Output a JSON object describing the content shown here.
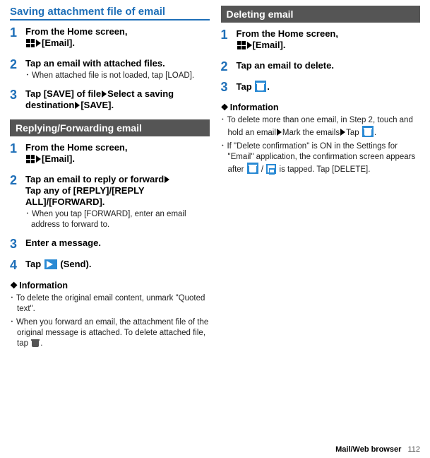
{
  "left": {
    "pageTitle": "Saving attachment file of email",
    "sectionA": {
      "steps": [
        {
          "num": "1",
          "title_pre": "From the Home screen, ",
          "title_post": "[Email]."
        },
        {
          "num": "2",
          "title": "Tap an email with attached files.",
          "note": "When attached file is not loaded, tap [LOAD]."
        },
        {
          "num": "3",
          "title_a": "Tap [SAVE] of file",
          "title_b": "Select a saving destination",
          "title_c": "[SAVE]."
        }
      ]
    },
    "sectionB": {
      "header": "Replying/Forwarding email",
      "steps": [
        {
          "num": "1",
          "title_pre": "From the Home screen, ",
          "title_post": "[Email]."
        },
        {
          "num": "2",
          "title_a": "Tap an email to reply or forward",
          "title_b": "Tap any of [REPLY]/[REPLY ALL]/[FORWARD].",
          "note": "When you tap [FORWARD], enter an email address to forward to."
        },
        {
          "num": "3",
          "title": "Enter a message."
        },
        {
          "num": "4",
          "title_a": "Tap ",
          "title_b": " (Send)."
        }
      ],
      "info_heading": "Information",
      "info": [
        "To delete the original email content, unmark \"Quoted text\".",
        "When you forward an email, the attachment file of the original message is attached. To delete attached file, tap "
      ]
    }
  },
  "right": {
    "sectionC": {
      "header": "Deleting email",
      "steps": [
        {
          "num": "1",
          "title_pre": "From the Home screen, ",
          "title_post": "[Email]."
        },
        {
          "num": "2",
          "title": "Tap an email to delete."
        },
        {
          "num": "3",
          "title_a": "Tap ",
          "title_b": "."
        }
      ],
      "info_heading": "Information",
      "info1_a": "To delete more than one email, in Step 2, touch and hold an email",
      "info1_b": "Mark the emails",
      "info1_c": "Tap ",
      "info1_d": ".",
      "info2_a": "If \"Delete confirmation\" is ON in the Settings for \"Email\" application, the confirmation screen appears after ",
      "info2_b": " / ",
      "info2_c": " is tapped. Tap [DELETE]."
    }
  },
  "footer": {
    "label": "Mail/Web browser",
    "page": "112"
  }
}
